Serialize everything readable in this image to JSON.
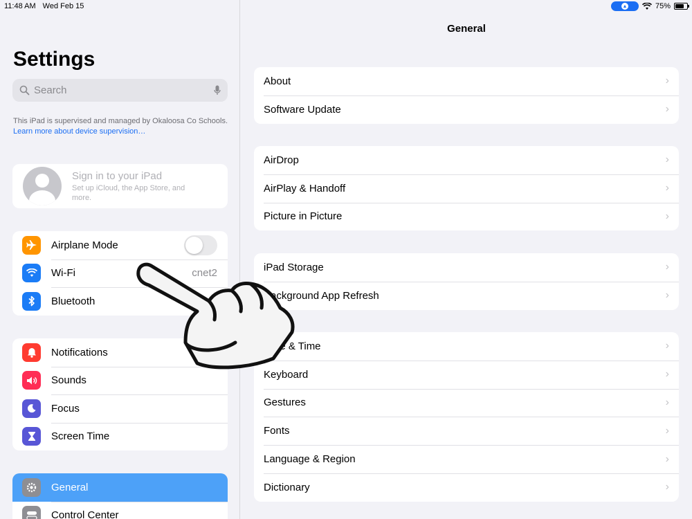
{
  "status": {
    "time": "11:48 AM",
    "date": "Wed Feb 15",
    "battery": "75%"
  },
  "sidebar": {
    "title": "Settings",
    "search_placeholder": "Search",
    "supervision_text": "This iPad is supervised and managed by Okaloosa Co Schools.",
    "supervision_link": "Learn more about device supervision…",
    "profile": {
      "title": "Sign in to your iPad",
      "subtitle": "Set up iCloud, the App Store, and more."
    },
    "group1": [
      {
        "label": "Airplane Mode",
        "value": "",
        "color": "#ff9500",
        "icon": "airplane-icon"
      },
      {
        "label": "Wi-Fi",
        "value": "cnet2",
        "color": "#1b7cf6",
        "icon": "wifi-icon"
      },
      {
        "label": "Bluetooth",
        "value": "",
        "color": "#1b7cf6",
        "icon": "bluetooth-icon"
      }
    ],
    "group2": [
      {
        "label": "Notifications",
        "color": "#ff3b30",
        "icon": "bell-icon"
      },
      {
        "label": "Sounds",
        "color": "#ff2d55",
        "icon": "speaker-icon"
      },
      {
        "label": "Focus",
        "color": "#5856d6",
        "icon": "moon-icon"
      },
      {
        "label": "Screen Time",
        "color": "#5856d6",
        "icon": "hourglass-icon"
      }
    ],
    "group3": [
      {
        "label": "General",
        "color": "#8e8e93",
        "icon": "gear-icon"
      },
      {
        "label": "Control Center",
        "color": "#8e8e93",
        "icon": "switches-icon"
      }
    ]
  },
  "main": {
    "title": "General",
    "groups": [
      [
        "About",
        "Software Update"
      ],
      [
        "AirDrop",
        "AirPlay & Handoff",
        "Picture in Picture"
      ],
      [
        "iPad Storage",
        "Background App Refresh"
      ],
      [
        "Date & Time",
        "Keyboard",
        "Gestures",
        "Fonts",
        "Language & Region",
        "Dictionary"
      ]
    ]
  }
}
